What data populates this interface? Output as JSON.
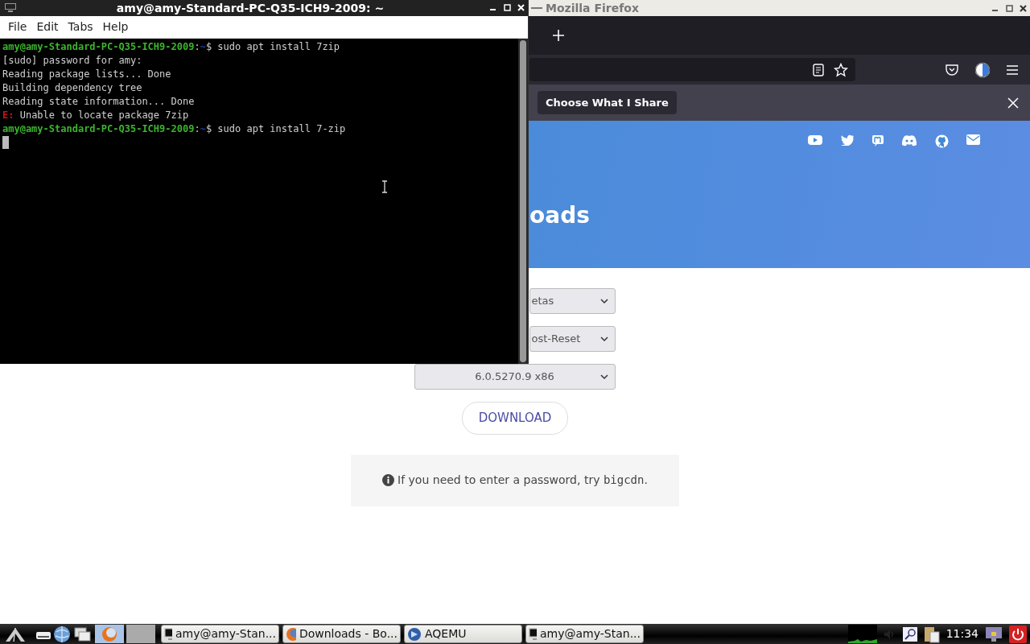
{
  "firefox": {
    "title": "Mozilla Firefox",
    "notification_button": "Choose What I Share",
    "page": {
      "heading": "oads",
      "selects": [
        "etas",
        "ost-Reset",
        "6.0.5270.9 x86"
      ],
      "download": "DOWNLOAD",
      "info": {
        "before": "If you need to enter a password, try ",
        "code": "bigcdn",
        "after": "."
      }
    }
  },
  "terminal": {
    "title": "amy@amy-Standard-PC-Q35-ICH9-2009: ~",
    "menu": [
      "File",
      "Edit",
      "Tabs",
      "Help"
    ],
    "lines": [
      [
        {
          "text": "amy@amy-Standard-PC-Q35-ICH9-2009",
          "kind": "user"
        },
        {
          "text": ":",
          "kind": "plain"
        },
        {
          "text": "~",
          "kind": "path"
        },
        {
          "text": "$ sudo apt install 7zip",
          "kind": "plain"
        }
      ],
      [
        {
          "text": "[sudo] password for amy:",
          "kind": "plain"
        }
      ],
      [
        {
          "text": "Reading package lists... Done",
          "kind": "plain"
        }
      ],
      [
        {
          "text": "Building dependency tree",
          "kind": "plain"
        }
      ],
      [
        {
          "text": "Reading state information... Done",
          "kind": "plain"
        }
      ],
      [
        {
          "text": "E:",
          "kind": "error"
        },
        {
          "text": " Unable to locate package 7zip",
          "kind": "plain"
        }
      ],
      [
        {
          "text": "amy@amy-Standard-PC-Q35-ICH9-2009",
          "kind": "user"
        },
        {
          "text": ":",
          "kind": "plain"
        },
        {
          "text": "~",
          "kind": "path"
        },
        {
          "text": "$ sudo apt install 7-zip",
          "kind": "plain"
        }
      ]
    ]
  },
  "taskbar": {
    "tasks": [
      {
        "label": "amy@amy-Stan...",
        "kind": "terminal"
      },
      {
        "label": "Downloads - Bo...",
        "kind": "firefox"
      },
      {
        "label": "AQEMU",
        "kind": "aqemu"
      },
      {
        "label": "amy@amy-Stan...",
        "kind": "terminal"
      }
    ],
    "clock": "11:34"
  }
}
